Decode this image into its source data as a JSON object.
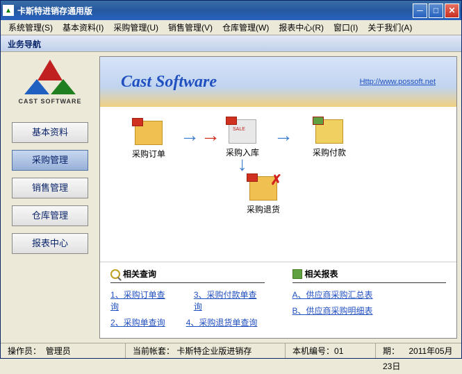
{
  "window": {
    "title": "卡斯特进销存通用版"
  },
  "menu": [
    "系统管理(S)",
    "基本资料(I)",
    "采购管理(U)",
    "销售管理(V)",
    "仓库管理(W)",
    "报表中心(R)",
    "窗口(I)",
    "关于我们(A)"
  ],
  "subtitle": "业务导航",
  "logo": {
    "text": "CAST SOFTWARE"
  },
  "nav": [
    {
      "label": "基本资料",
      "active": false
    },
    {
      "label": "采购管理",
      "active": true
    },
    {
      "label": "销售管理",
      "active": false
    },
    {
      "label": "仓库管理",
      "active": false
    },
    {
      "label": "报表中心",
      "active": false
    }
  ],
  "header": {
    "title": "Cast Software",
    "link": "Http://www.possoft.net"
  },
  "flow": {
    "order": "采购订单",
    "inbound": "采购入库",
    "payment": "采购付款",
    "return": "采购退货"
  },
  "bottom": {
    "queries_title": "相关查询",
    "reports_title": "相关报表",
    "queries": [
      "1、采购订单查询",
      "3、采购付款单查询",
      "2、采购单查询",
      "4、采购退货单查询"
    ],
    "reports": [
      "A、供应商采购汇总表",
      "B、供应商采购明细表"
    ]
  },
  "status": {
    "operator_label": "操作员：",
    "operator": "管理员",
    "account_label": "当前帐套：",
    "account": "卡斯特企业版进销存",
    "machine_label": "本机编号：",
    "machine": "01",
    "date_label": "期：",
    "date": "2011年05月23日"
  }
}
